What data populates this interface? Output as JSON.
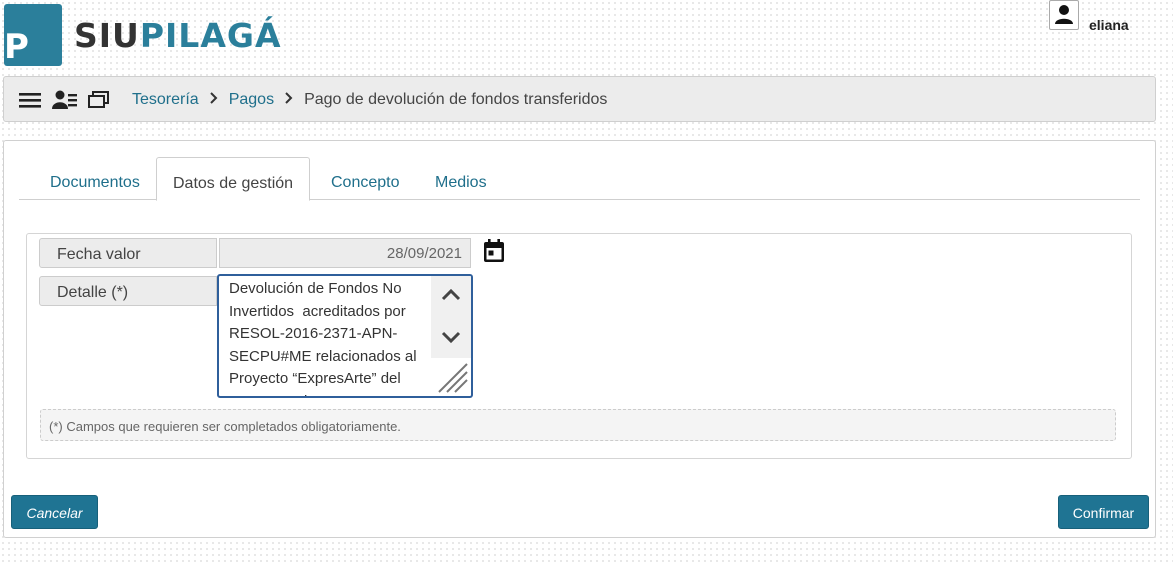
{
  "header": {
    "logo_letter": "P",
    "logo_part1": "SIU",
    "logo_part2": "PILAGÁ",
    "user_name": "eliana"
  },
  "breadcrumb": {
    "items": [
      "Tesorería",
      "Pagos"
    ],
    "current": "Pago de devolución de fondos transferidos"
  },
  "tabs": [
    {
      "label": "Documentos"
    },
    {
      "label": "Datos de gestión"
    },
    {
      "label": "Concepto"
    },
    {
      "label": "Medios"
    }
  ],
  "form": {
    "fecha_label": "Fecha valor",
    "fecha_value": "28/09/2021",
    "detalle_label": "Detalle (*)",
    "detalle_value": "Devolución de Fondos No Invertidos  acreditados por RESOL-2016-2371-APN-SECPU#ME relacionados al Proyecto “ExpresArte” del Programa de",
    "note": "(*) Campos que requieren ser completados obligatoriamente."
  },
  "buttons": {
    "cancel": "Cancelar",
    "confirm": "Confirmar"
  },
  "colors": {
    "brand": "#2b7f9b",
    "link": "#1f6f8b",
    "button": "#1f7493",
    "focus_border": "#2f5f9b"
  }
}
